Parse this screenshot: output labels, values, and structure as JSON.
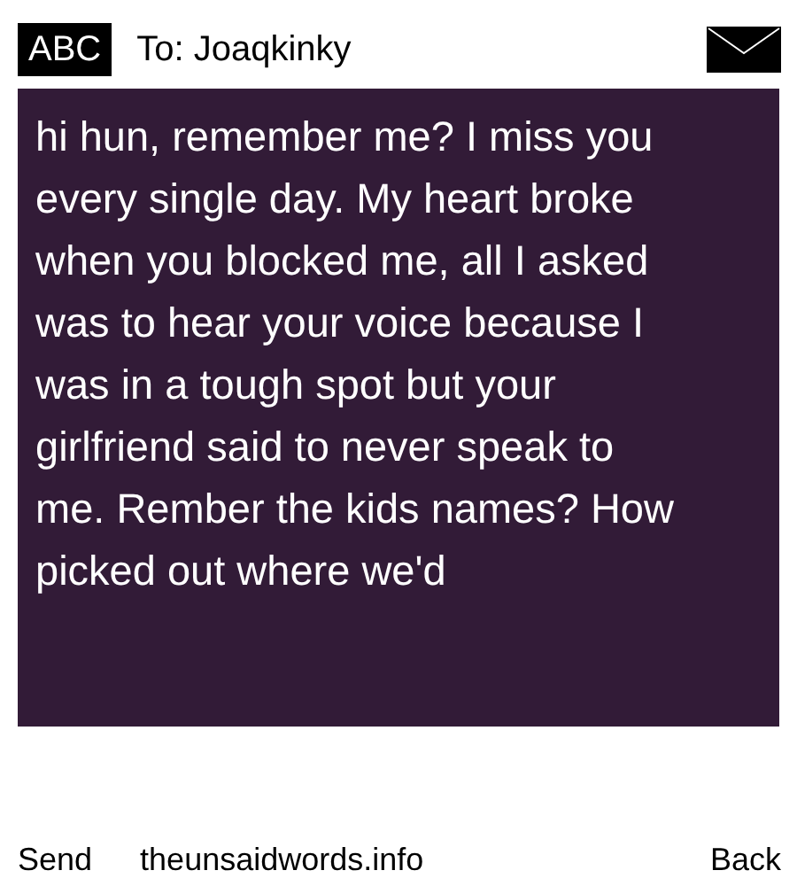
{
  "header": {
    "input_mode": "ABC",
    "recipient": "To: Joaqkinky"
  },
  "message": {
    "text": "hi hun, remember me? I miss you\nevery single day. My heart broke\nwhen you blocked me, all I asked\nwas to hear your voice because I\nwas in a tough spot but your\ngirlfriend said to never speak to\nme. Rember the kids names? How\npicked out where we'd"
  },
  "footer": {
    "left": "Send",
    "center": "theunsaidwords.info",
    "right": "Back"
  }
}
